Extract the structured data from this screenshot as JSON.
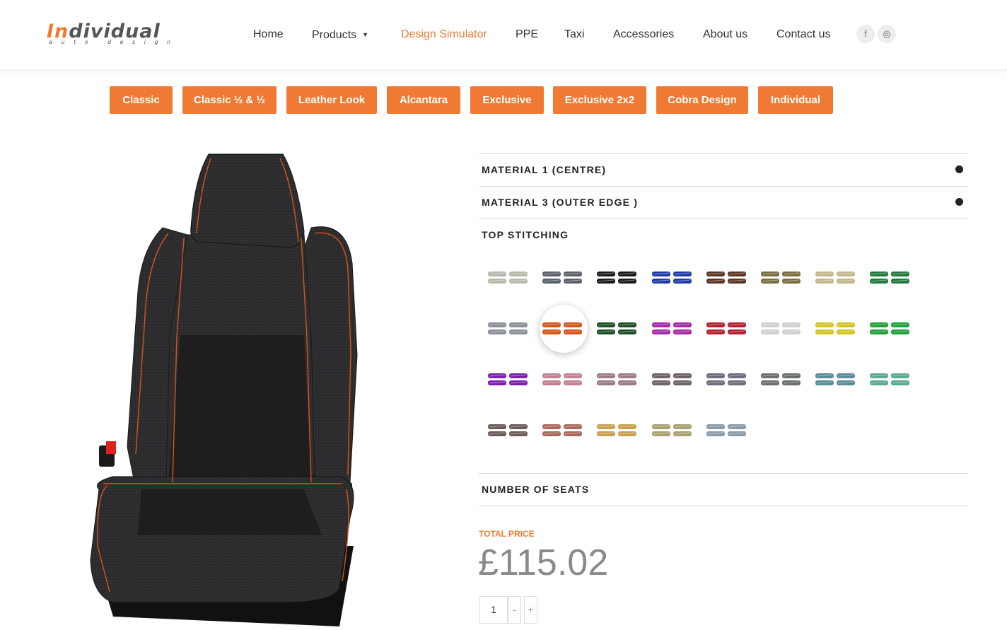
{
  "header": {
    "logo": {
      "first": "In",
      "rest": "dividual",
      "tagline": "auto design"
    },
    "nav": [
      {
        "label": "Home"
      },
      {
        "label": "Products"
      },
      {
        "label": "Design Simulator"
      },
      {
        "label": "PPE"
      },
      {
        "label": "Taxi"
      },
      {
        "label": "Accessories"
      },
      {
        "label": "About us"
      },
      {
        "label": "Contact us"
      }
    ],
    "social": [
      {
        "icon": "facebook-icon",
        "glyph": "f"
      },
      {
        "icon": "instagram-icon",
        "glyph": "◎"
      }
    ]
  },
  "categories": [
    "Classic",
    "Classic ½ & ½",
    "Leather Look",
    "Alcantara",
    "Exclusive",
    "Exclusive 2x2",
    "Cobra Design",
    "Individual"
  ],
  "accordion": {
    "material1": "MATERIAL 1 (CENTRE)",
    "material3": "MATERIAL 3 (OUTER EDGE )",
    "stitching": "TOP STITCHING",
    "seats": "NUMBER OF SEATS"
  },
  "stitch_colors": [
    "#b8b8ac",
    "#5a5f68",
    "#1a1a1a",
    "#1f3aa8",
    "#5a3420",
    "#7a6d40",
    "#c2b78a",
    "#1f7a3a",
    "#8a8f98",
    "#d4561a",
    "#1d4d28",
    "#a42aa8",
    "#b3202e",
    "#cfcfcf",
    "#d4c421",
    "#1fa03a",
    "#7a1fb0",
    "#c08090",
    "#9a7a84",
    "#6d5f66",
    "#6e6a80",
    "#6a6e6a",
    "#5a8a9a",
    "#5aa890",
    "#6a5a58",
    "#a86a5a",
    "#c8a050",
    "#a8a070",
    "#8a9aa8"
  ],
  "selected_stitch_index": 9,
  "price": {
    "label": "TOTAL PRICE",
    "value": "£115.02"
  },
  "quantity": {
    "value": "1",
    "minus": "-",
    "plus": "+"
  },
  "colors": {
    "accent": "#f07a33",
    "seat_fabric": "#2b2b2d",
    "stitch": "#d4561a"
  }
}
